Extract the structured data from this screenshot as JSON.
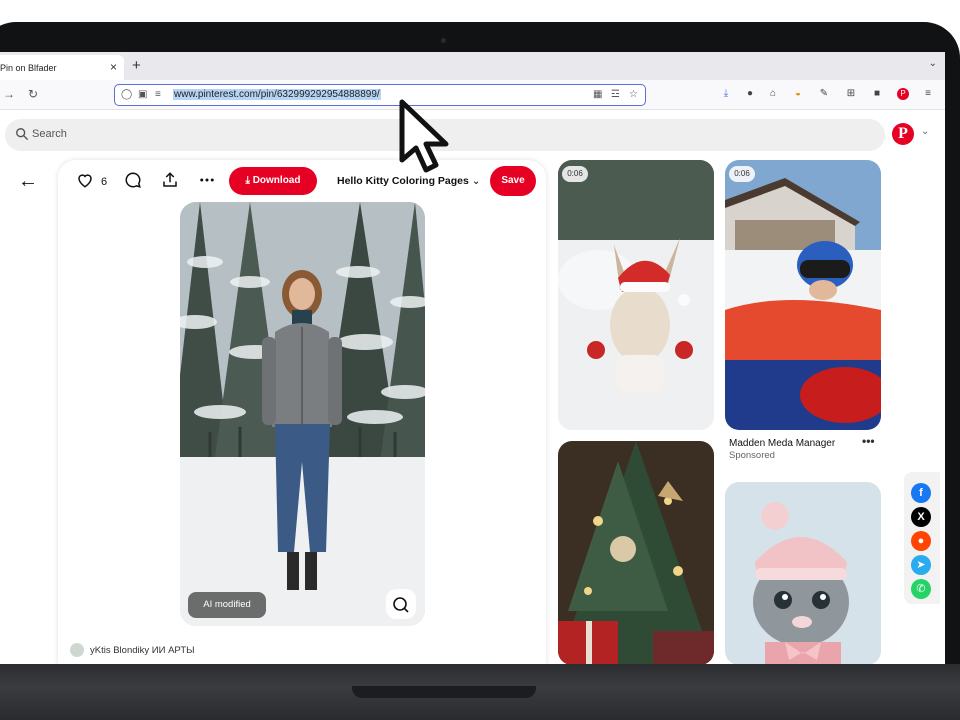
{
  "browser": {
    "tab_title": "Pin on Blfader",
    "tab_close": "×",
    "new_tab": "+",
    "url": "www.pinterest.com/pin/632999292954888899/"
  },
  "header": {
    "search_placeholder": "Search"
  },
  "pin": {
    "like_count": "6",
    "download_label": "Download",
    "board_name": "Hello Kitty Coloring Pages",
    "save_label": "Save",
    "ai_badge": "AI modified",
    "creator_name": "yKtis Blondiky ИИ АРТЫ"
  },
  "feed": {
    "badge_label": "0:06",
    "sponsored_title": "Madden Meda Manager",
    "sponsored_sub": "Sponsored",
    "more_label": "•••"
  },
  "share": {
    "items": [
      "facebook",
      "x",
      "reddit",
      "telegram",
      "whatsapp"
    ],
    "colors": {
      "facebook": "#1877f2",
      "x": "#000000",
      "reddit": "#ff4500",
      "telegram": "#2aabee",
      "whatsapp": "#25d366"
    }
  },
  "colors": {
    "brand": "#e60023",
    "url_highlight": "#b5d4f4",
    "frame": "#111214"
  }
}
